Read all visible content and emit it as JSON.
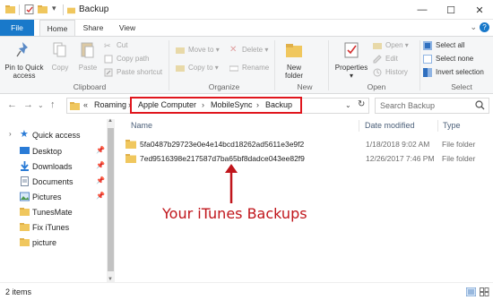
{
  "window": {
    "title": "Backup",
    "minimize": "—",
    "maximize": "☐",
    "close": "✕"
  },
  "tabs": {
    "file": "File",
    "home": "Home",
    "share": "Share",
    "view": "View"
  },
  "ribbon": {
    "clipboard": {
      "pin_label_1": "Pin to Quick",
      "pin_label_2": "access",
      "copy": "Copy",
      "paste": "Paste",
      "cut": "Cut",
      "copy_path": "Copy path",
      "paste_shortcut": "Paste shortcut",
      "group": "Clipboard"
    },
    "organize": {
      "move_to": "Move to",
      "copy_to": "Copy to",
      "delete": "Delete",
      "rename": "Rename",
      "group": "Organize"
    },
    "new": {
      "new_folder_1": "New",
      "new_folder_2": "folder",
      "group": "New"
    },
    "open": {
      "properties": "Properties",
      "open": "Open",
      "edit": "Edit",
      "history": "History",
      "group": "Open"
    },
    "select": {
      "select_all": "Select all",
      "select_none": "Select none",
      "invert": "Invert selection",
      "group": "Select"
    }
  },
  "address": {
    "prefix": "«",
    "crumbs": [
      "Roaming",
      "Apple Computer",
      "MobileSync",
      "Backup"
    ],
    "search_placeholder": "Search Backup"
  },
  "nav": {
    "quick_access": "Quick access",
    "items": [
      {
        "label": "Desktop",
        "pinned": true
      },
      {
        "label": "Downloads",
        "pinned": true
      },
      {
        "label": "Documents",
        "pinned": true
      },
      {
        "label": "Pictures",
        "pinned": true
      },
      {
        "label": "TunesMate",
        "pinned": false
      },
      {
        "label": "Fix iTunes",
        "pinned": false
      },
      {
        "label": "picture",
        "pinned": false
      }
    ]
  },
  "files": {
    "columns": {
      "name": "Name",
      "date": "Date modified",
      "type": "Type"
    },
    "rows": [
      {
        "name": "5fa0487b29723e0e4e14bcd18262ad5611e3e9f2",
        "date": "1/18/2018 9:02 AM",
        "type": "File folder"
      },
      {
        "name": "7ed9516398e217587d7ba65bf8dadce043ee82f9",
        "date": "12/26/2017 7:46 PM",
        "type": "File folder"
      }
    ]
  },
  "annotation": "Your iTunes Backups",
  "status": {
    "count": "2 items"
  },
  "colors": {
    "accent": "#1979ca",
    "folder": "#f0c75e",
    "annotation": "#c0151b"
  }
}
